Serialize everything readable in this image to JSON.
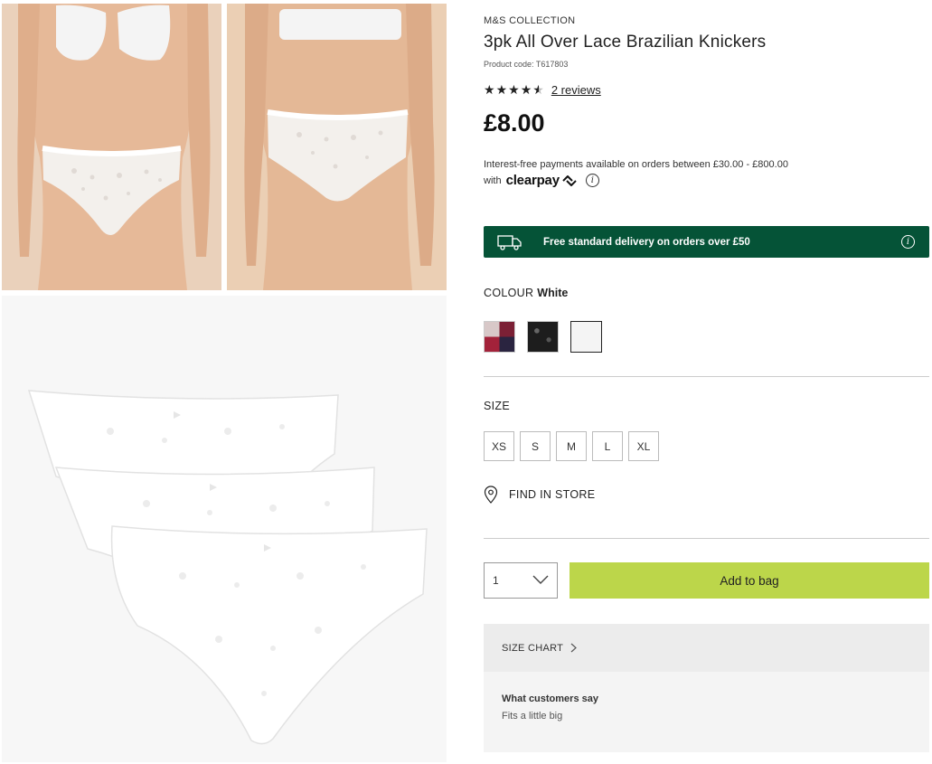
{
  "product": {
    "brand": "M&S COLLECTION",
    "title": "3pk All Over Lace Brazilian Knickers",
    "code": "Product code: T617803",
    "rating": 4.5,
    "reviews": "2 reviews",
    "price": "£8.00",
    "finance_line1": "Interest-free payments available on orders between £30.00 - £800.00",
    "finance_with": "with",
    "finance_brand": "clearpay",
    "info_glyph": "i"
  },
  "delivery": {
    "text": "Free standard delivery on orders over £50",
    "bg_color": "#055337",
    "icon": "truck-icon"
  },
  "colour": {
    "label": "COLOUR",
    "value": "White",
    "swatches": [
      {
        "name": "multi",
        "selected": false
      },
      {
        "name": "black",
        "selected": false
      },
      {
        "name": "white",
        "selected": true
      }
    ]
  },
  "size": {
    "label": "SIZE",
    "options": [
      "XS",
      "S",
      "M",
      "L",
      "XL"
    ]
  },
  "store": {
    "label": "FIND IN STORE",
    "icon": "location-pin-icon"
  },
  "purchase": {
    "quantity": "1",
    "add_label": "Add to bag",
    "add_color": "#bcd64a"
  },
  "size_chart": {
    "label": "SIZE CHART"
  },
  "customers": {
    "heading": "What customers say",
    "body": "Fits a little big"
  }
}
